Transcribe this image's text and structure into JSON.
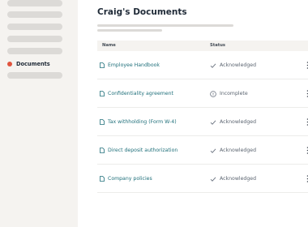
{
  "sidebar": {
    "active_item": {
      "label": "Documents",
      "dot_color": "#e0533d"
    }
  },
  "page": {
    "title": "Craig's Documents"
  },
  "table": {
    "columns": {
      "name": "Name",
      "status": "Status"
    },
    "rows": [
      {
        "name": "Employee Handbook",
        "status": "Acknowledged",
        "status_icon": "check-icon"
      },
      {
        "name": "Confidentiality agreement",
        "status": "Incomplete",
        "status_icon": "info-circle-icon"
      },
      {
        "name": "Tax withholding (Form W-4)",
        "status": "Acknowledged",
        "status_icon": "check-icon"
      },
      {
        "name": "Direct deposit authorization",
        "status": "Acknowledged",
        "status_icon": "check-icon"
      },
      {
        "name": "Company policies",
        "status": "Acknowledged",
        "status_icon": "check-icon"
      }
    ]
  },
  "colors": {
    "accent_link": "#1f6f7a",
    "active_dot": "#e0533d",
    "sidebar_bg": "#f5f3f0"
  }
}
